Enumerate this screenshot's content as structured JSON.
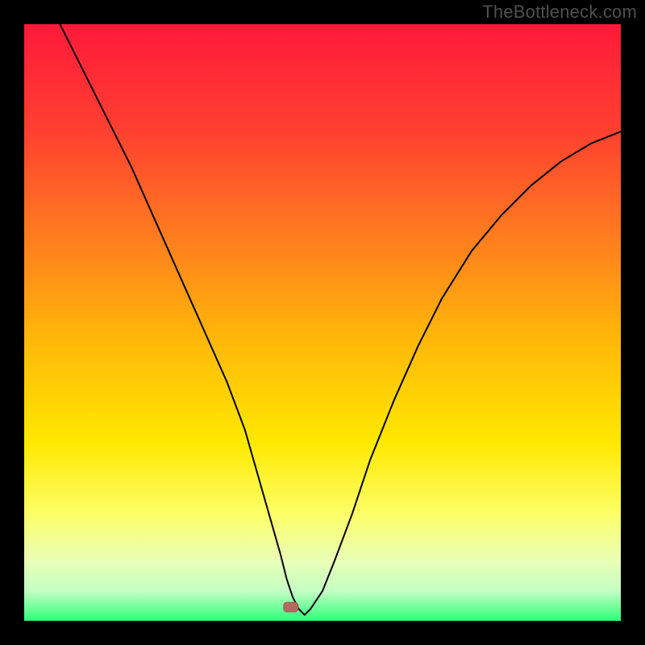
{
  "watermark": "TheBottleneck.com",
  "chart_data": {
    "type": "line",
    "title": "",
    "xlabel": "",
    "ylabel": "",
    "xlim": [
      0,
      100
    ],
    "ylim": [
      0,
      100
    ],
    "grid": false,
    "legend": false,
    "gradient": {
      "stops": [
        {
          "offset": 0.0,
          "color": "#ff1a3a"
        },
        {
          "offset": 0.18,
          "color": "#ff4030"
        },
        {
          "offset": 0.35,
          "color": "#ff7a1f"
        },
        {
          "offset": 0.52,
          "color": "#ffb50a"
        },
        {
          "offset": 0.7,
          "color": "#ffe800"
        },
        {
          "offset": 0.82,
          "color": "#fcff66"
        },
        {
          "offset": 0.9,
          "color": "#e9ffb8"
        },
        {
          "offset": 0.95,
          "color": "#c4ffc4"
        },
        {
          "offset": 1.0,
          "color": "#2eff7a"
        }
      ]
    },
    "series": [
      {
        "name": "bottleneck-curve",
        "x": [
          6,
          10,
          14,
          18,
          22,
          26,
          30,
          34,
          37,
          39,
          41,
          43,
          44,
          45,
          46,
          47,
          48,
          50,
          52,
          55,
          58,
          62,
          66,
          70,
          75,
          80,
          85,
          90,
          95,
          100
        ],
        "y": [
          100,
          92,
          84,
          76,
          67,
          58,
          49,
          40,
          32,
          25,
          18,
          11,
          7,
          4,
          2,
          1,
          2,
          5,
          10,
          18,
          27,
          37,
          46,
          54,
          62,
          68,
          73,
          77,
          80,
          82
        ]
      }
    ],
    "marker": {
      "x": 44.7,
      "y": 2.3,
      "color": "#b5695d"
    }
  }
}
